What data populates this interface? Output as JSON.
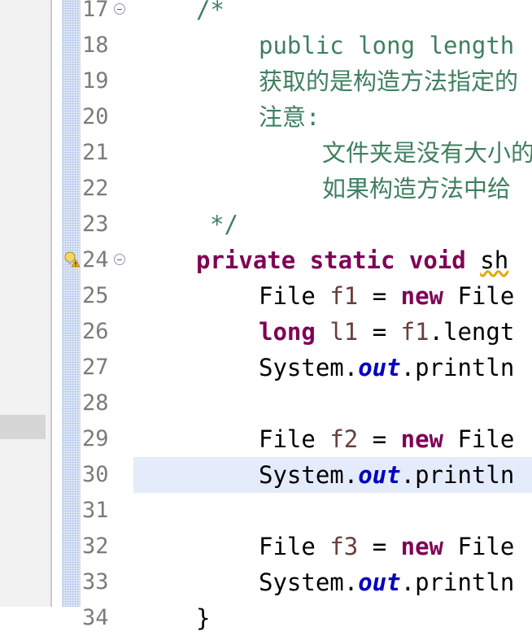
{
  "editor": {
    "lines": [
      {
        "num": "17",
        "segs": [
          {
            "t": "/*",
            "c": "comment"
          }
        ],
        "indent": 241,
        "fold": true
      },
      {
        "num": "18",
        "segs": [
          {
            "t": "public long length",
            "c": "comment"
          }
        ],
        "indent": 318
      },
      {
        "num": "19",
        "segs": [
          {
            "t": "获取的是构造方法指定的",
            "c": "comment"
          }
        ],
        "indent": 318
      },
      {
        "num": "20",
        "segs": [
          {
            "t": "注意:",
            "c": "comment"
          }
        ],
        "indent": 318
      },
      {
        "num": "21",
        "segs": [
          {
            "t": "文件夹是没有大小的",
            "c": "comment"
          }
        ],
        "indent": 396
      },
      {
        "num": "22",
        "segs": [
          {
            "t": "如果构造方法中给",
            "c": "comment"
          }
        ],
        "indent": 396
      },
      {
        "num": "23",
        "segs": [
          {
            "t": "*/",
            "c": "comment"
          }
        ],
        "indent": 258
      },
      {
        "num": "24",
        "segs": [
          {
            "t": "private",
            "c": "kw"
          },
          {
            "t": " ",
            "c": "plain"
          },
          {
            "t": "static",
            "c": "kw"
          },
          {
            "t": " ",
            "c": "plain"
          },
          {
            "t": "void",
            "c": "kw"
          },
          {
            "t": " ",
            "c": "plain"
          },
          {
            "t": "sh",
            "c": "squiggle"
          }
        ],
        "indent": 241,
        "fold": true,
        "warning": true
      },
      {
        "num": "25",
        "segs": [
          {
            "t": "File ",
            "c": "plain"
          },
          {
            "t": "f1",
            "c": "var"
          },
          {
            "t": " = ",
            "c": "plain"
          },
          {
            "t": "new",
            "c": "kw"
          },
          {
            "t": " File",
            "c": "plain"
          }
        ],
        "indent": 318
      },
      {
        "num": "26",
        "segs": [
          {
            "t": "long",
            "c": "kw"
          },
          {
            "t": " ",
            "c": "plain"
          },
          {
            "t": "l1",
            "c": "var"
          },
          {
            "t": " = ",
            "c": "plain"
          },
          {
            "t": "f1",
            "c": "var"
          },
          {
            "t": ".lengt",
            "c": "plain"
          }
        ],
        "indent": 318
      },
      {
        "num": "27",
        "segs": [
          {
            "t": "System.",
            "c": "plain"
          },
          {
            "t": "out",
            "c": "field"
          },
          {
            "t": ".println",
            "c": "plain"
          }
        ],
        "indent": 318
      },
      {
        "num": "28",
        "segs": [],
        "indent": 318
      },
      {
        "num": "29",
        "segs": [
          {
            "t": "File ",
            "c": "plain"
          },
          {
            "t": "f2",
            "c": "var"
          },
          {
            "t": " = ",
            "c": "plain"
          },
          {
            "t": "new",
            "c": "kw"
          },
          {
            "t": " File",
            "c": "plain"
          }
        ],
        "indent": 318
      },
      {
        "num": "30",
        "segs": [
          {
            "t": "System.",
            "c": "plain"
          },
          {
            "t": "out",
            "c": "field"
          },
          {
            "t": ".println",
            "c": "plain"
          }
        ],
        "indent": 318,
        "current": true
      },
      {
        "num": "31",
        "segs": [],
        "indent": 318
      },
      {
        "num": "32",
        "segs": [
          {
            "t": "File ",
            "c": "plain"
          },
          {
            "t": "f3",
            "c": "var"
          },
          {
            "t": " = ",
            "c": "plain"
          },
          {
            "t": "new",
            "c": "kw"
          },
          {
            "t": " File",
            "c": "plain"
          }
        ],
        "indent": 318
      },
      {
        "num": "33",
        "segs": [
          {
            "t": "System.",
            "c": "plain"
          },
          {
            "t": "out",
            "c": "field"
          },
          {
            "t": ".println",
            "c": "plain"
          }
        ],
        "indent": 318
      },
      {
        "num": "34",
        "segs": [
          {
            "t": "}",
            "c": "plain"
          }
        ],
        "indent": 241
      }
    ]
  },
  "icons": {
    "fold": "collapse-icon",
    "warning": "warning-lightbulb-icon"
  }
}
